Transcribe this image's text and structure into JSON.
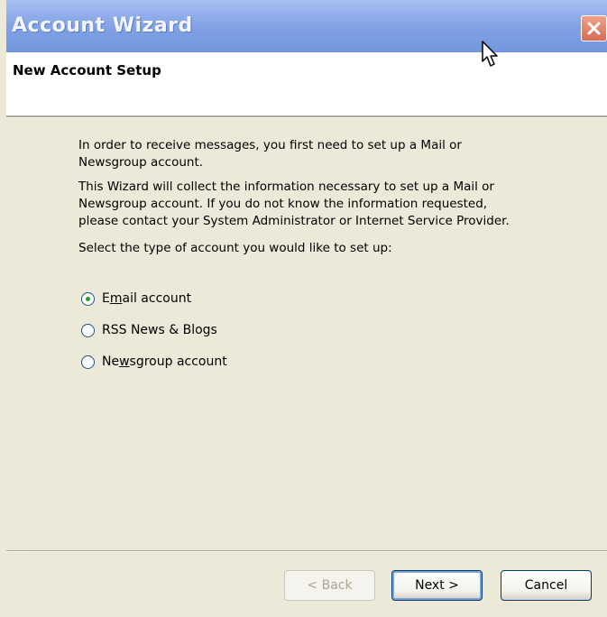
{
  "window": {
    "title": "Account Wizard",
    "close_label": "Close"
  },
  "header": {
    "title": "New Account Setup"
  },
  "body": {
    "intro": "In order to receive messages, you first need to set up a Mail or\nNewsgroup account.",
    "info": "This Wizard will collect the information necessary to set up a Mail or\nNewsgroup account. If you do not know the information requested,\nplease contact your System Administrator or Internet Service Provider.",
    "prompt": "Select the type of account you would like to set up:"
  },
  "account_types": {
    "selected": "Email account",
    "options": [
      {
        "pre": "E",
        "accel": "m",
        "post": "ail account",
        "checked": true
      },
      {
        "pre": "RSS News & Blogs",
        "accel": "",
        "post": "",
        "checked": false
      },
      {
        "pre": "Ne",
        "accel": "w",
        "post": "sgroup account",
        "checked": false
      }
    ]
  },
  "buttons": {
    "back": "< Back",
    "next": "Next >",
    "cancel": "Cancel"
  }
}
